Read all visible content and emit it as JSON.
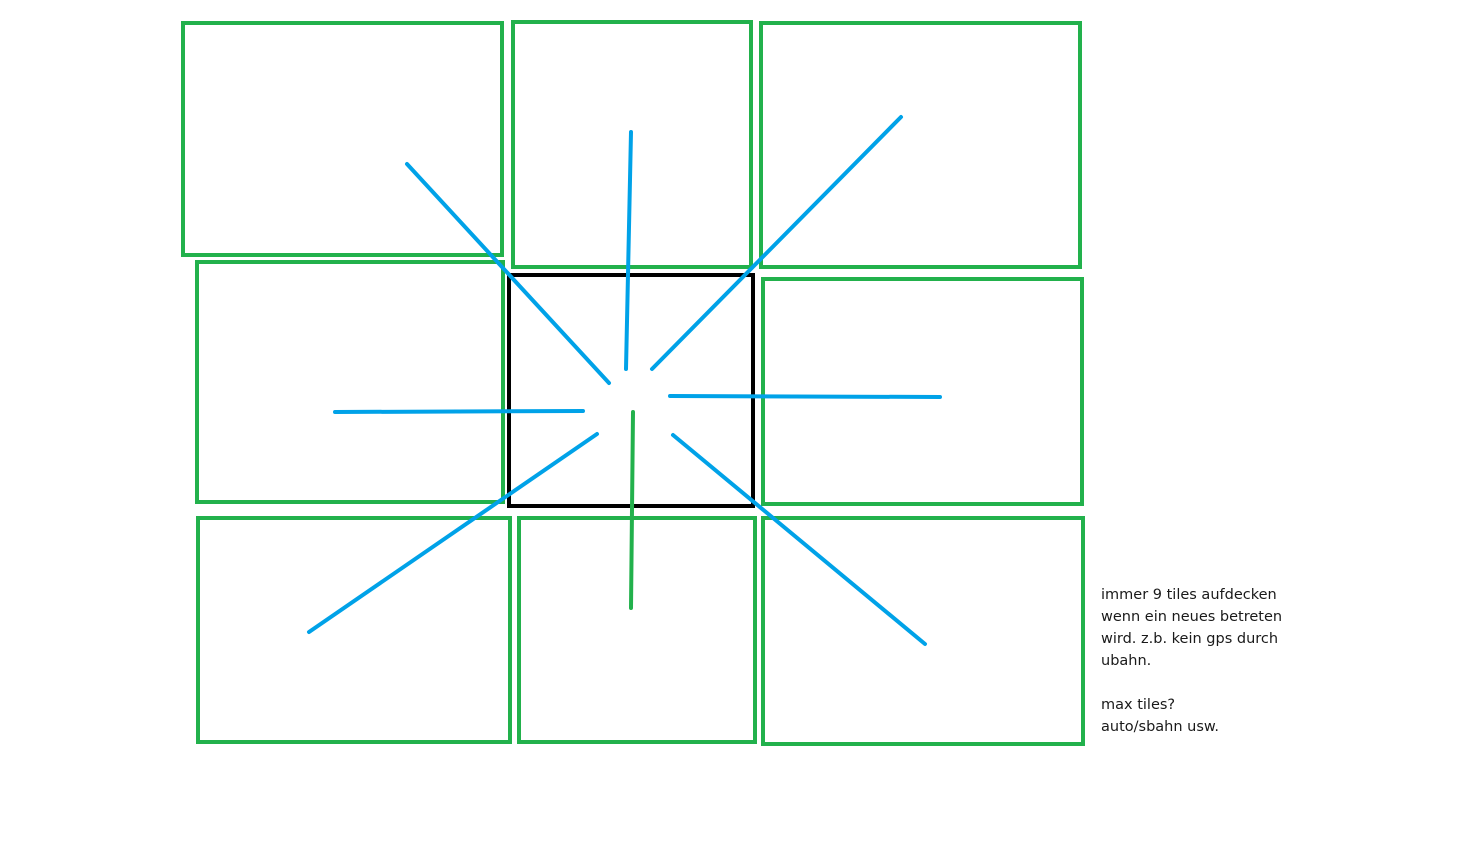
{
  "diagram": {
    "colors": {
      "neighbor_tile": "#22b14c",
      "center_tile": "#000000",
      "reveal_arrow": "#00a2e8"
    },
    "tiles": [
      {
        "id": "top-left",
        "role": "neighbor"
      },
      {
        "id": "top-center",
        "role": "neighbor"
      },
      {
        "id": "top-right",
        "role": "neighbor"
      },
      {
        "id": "middle-left",
        "role": "neighbor"
      },
      {
        "id": "center",
        "role": "current"
      },
      {
        "id": "middle-right",
        "role": "neighbor"
      },
      {
        "id": "bottom-left",
        "role": "neighbor"
      },
      {
        "id": "bottom-center",
        "role": "neighbor"
      },
      {
        "id": "bottom-right",
        "role": "neighbor"
      }
    ],
    "rays": [
      {
        "direction": "up-left",
        "color": "reveal_arrow"
      },
      {
        "direction": "up",
        "color": "reveal_arrow"
      },
      {
        "direction": "up-right",
        "color": "reveal_arrow"
      },
      {
        "direction": "left",
        "color": "reveal_arrow"
      },
      {
        "direction": "right",
        "color": "reveal_arrow"
      },
      {
        "direction": "down-left",
        "color": "reveal_arrow"
      },
      {
        "direction": "down",
        "color": "neighbor_tile"
      },
      {
        "direction": "down-right",
        "color": "reveal_arrow"
      }
    ]
  },
  "note": {
    "lines": [
      "immer 9 tiles aufdecken",
      "wenn ein neues betreten",
      "wird. z.b. kein gps durch",
      "ubahn.",
      "",
      "max tiles?",
      "auto/sbahn usw."
    ]
  }
}
